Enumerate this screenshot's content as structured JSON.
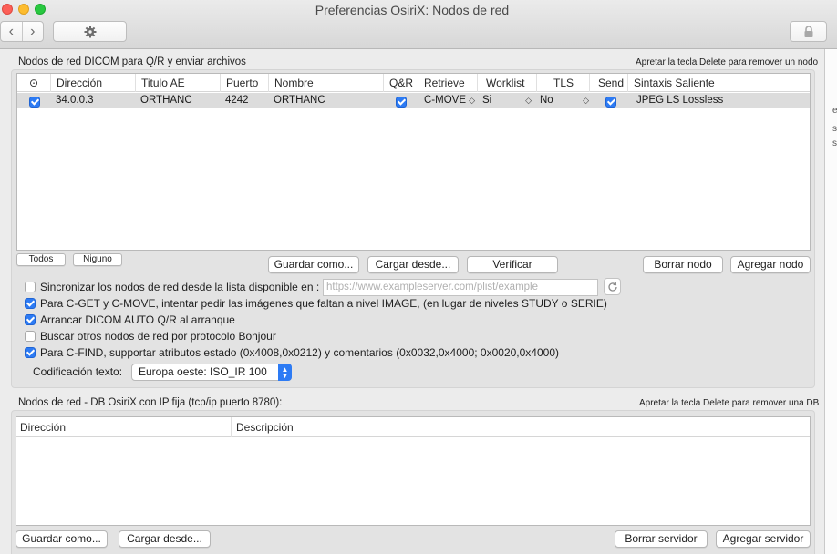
{
  "window": {
    "title": "Preferencias OsiriX: Nodos de red"
  },
  "toolbar": {
    "back_glyph": "‹",
    "forward_glyph": "›",
    "gear_icon": "gear-icon",
    "lock_icon": "lock-icon"
  },
  "dicom_nodes": {
    "group_label": "Nodos de red DICOM para Q/R y enviar archivos",
    "hint": "Apretar la tecla Delete para remover un nodo",
    "columns": [
      "⊙",
      "Dirección",
      "Titulo AE",
      "Puerto",
      "Nombre",
      "Q&R",
      "Retrieve",
      "Worklist",
      "TLS",
      "Send",
      "Sintaxis Saliente"
    ],
    "rows": [
      {
        "enabled": true,
        "address": "34.0.0.3",
        "ae_title": "ORTHANC",
        "port": "4242",
        "name": "ORTHANC",
        "qr": true,
        "retrieve": "C-MOVE",
        "worklist": "Si",
        "tls": "No",
        "send": true,
        "syntax": "JPEG LS Lossless"
      }
    ],
    "buttons": {
      "todos": "Todos",
      "ninguno": "Niguno",
      "save_as": "Guardar como...",
      "load_from": "Cargar desde...",
      "verify": "Verificar",
      "delete_node": "Borrar nodo",
      "add_node": "Agregar nodo"
    },
    "options": {
      "sync_label": "Sincronizar los nodos de red desde la lista disponible en :",
      "sync_checked": false,
      "sync_url_placeholder": "https://www.exampleserver.com/plist/example",
      "cget_label": "Para C-GET y C-MOVE, intentar pedir las imágenes que faltan a nivel IMAGE, (en lugar de niveles STUDY o SERIE)",
      "cget_checked": true,
      "auto_qr_label": "Arrancar DICOM AUTO Q/R al arranque",
      "auto_qr_checked": true,
      "bonjour_label": "Buscar otros nodos de red por protocolo Bonjour",
      "bonjour_checked": false,
      "cfind_label": "Para C-FIND, supportar atributos estado (0x4008,0x0212) y comentarios (0x0032,0x4000; 0x0020,0x4000)",
      "cfind_checked": true
    },
    "encoding": {
      "label": "Codificación texto:",
      "value": "Europa oeste: ISO_IR 100"
    }
  },
  "osirix_nodes": {
    "group_label": "Nodos de red - DB OsiriX con IP fija (tcp/ip puerto 8780):",
    "hint": "Apretar la tecla Delete para remover una DB",
    "columns": [
      "Dirección",
      "Descripción"
    ],
    "buttons": {
      "save_as": "Guardar como...",
      "load_from": "Cargar desde...",
      "delete_server": "Borrar servidor",
      "add_server": "Agregar servidor"
    }
  },
  "colors": {
    "accent": "#2d7bf4",
    "row_selected": "#dcdcdc",
    "panel": "#e3e3e3"
  }
}
